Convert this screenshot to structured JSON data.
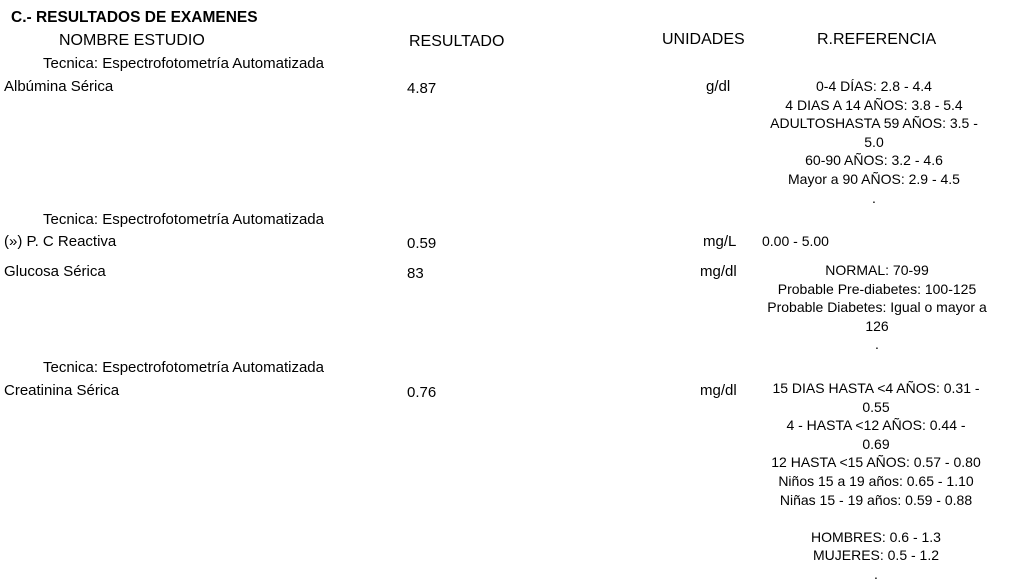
{
  "section_title": "C.- RESULTADOS DE EXAMENES",
  "headers": {
    "study": "NOMBRE ESTUDIO",
    "result": "RESULTADO",
    "units": "UNIDADES",
    "reference": "R.REFERENCIA"
  },
  "technique_label": "Tecnica: Espectrofotometría Automatizada",
  "rows": [
    {
      "name": "Albúmina Sérica",
      "result": "4.87",
      "units": "g/dl",
      "reference": [
        "0-4 DÍAS:    2.8  -  4.4",
        "4 DIAS A 14 AÑOS: 3.8 - 5.4",
        "ADULTOSHASTA 59 AÑOS: 3.5 -",
        "5.0",
        "60-90 AÑOS: 3.2 - 4.6",
        "Mayor a 90 AÑOS: 2.9 - 4.5",
        "."
      ]
    },
    {
      "name": "(») P. C Reactiva",
      "result": "0.59",
      "units": "mg/L",
      "reference": [
        "0.00 - 5.00"
      ]
    },
    {
      "name": "Glucosa Sérica",
      "result": "83",
      "units": "mg/dl",
      "reference": [
        "NORMAL: 70-99",
        "Probable Pre-diabetes: 100-125",
        "Probable Diabetes: Igual o mayor a",
        "126",
        "."
      ]
    },
    {
      "name": "Creatinina Sérica",
      "result": "0.76",
      "units": "mg/dl",
      "reference": [
        "15 DIAS HASTA <4 AÑOS:  0.31 -",
        "0.55",
        "4 - HASTA <12 AÑOS: 0.44 -",
        "0.69",
        "12 HASTA <15 AÑOS: 0.57 - 0.80",
        "Niños 15 a 19 años:  0.65 - 1.10",
        "Niñas 15 - 19 años: 0.59 - 0.88",
        "",
        "HOMBRES: 0.6 - 1.3",
        "MUJERES: 0.5 - 1.2",
        "."
      ]
    }
  ]
}
